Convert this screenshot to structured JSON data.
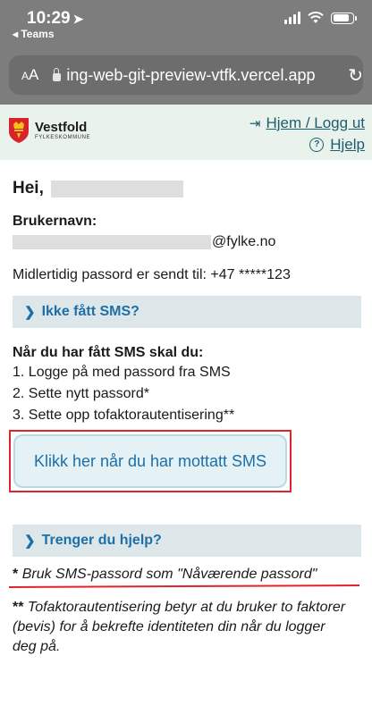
{
  "status_bar": {
    "time": "10:29",
    "back_app": "◂ Teams",
    "battery_level": 0.85
  },
  "browser": {
    "text_size": "AA",
    "url": "ing-web-git-preview-vtfk.vercel.app"
  },
  "header": {
    "logo_name": "Vestfold",
    "logo_sub": "FYLKESKOMMUNE",
    "home_logout": "Hjem / Logg ut",
    "help": "Hjelp"
  },
  "main": {
    "greeting": "Hei,",
    "username_label": "Brukernavn:",
    "username_suffix": "@fylke.no",
    "temp_password": "Midlertidig passord er sendt til: +47 *****123",
    "accordion_sms": "Ikke fått SMS?",
    "steps_title": "Når du har fått SMS skal du:",
    "steps": [
      "1. Logge på med passord fra SMS",
      "2. Sette nytt passord*",
      "3. Sette opp tofaktorautentisering**"
    ],
    "cta": "Klikk her når du har mottatt SMS",
    "accordion_help": "Trenger du hjelp?",
    "note1_marker": "*",
    "note1": "Bruk SMS-passord som \"Nåværende passord\"",
    "note2_marker": "**",
    "note2": "Tofaktorautentisering betyr at du bruker to faktorer (bevis) for å bekrefte identiteten din når du logger deg på."
  }
}
